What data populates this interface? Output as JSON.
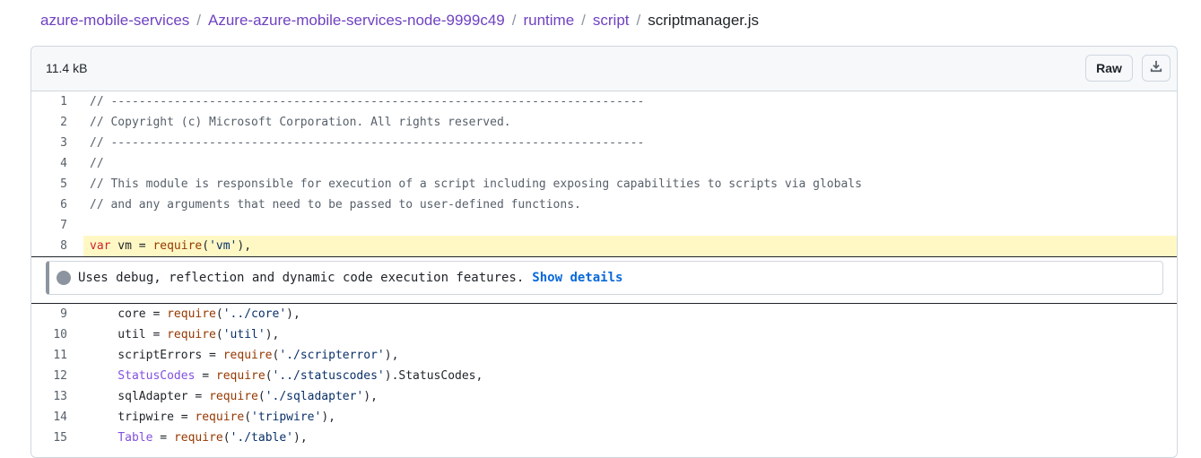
{
  "breadcrumb": {
    "items": [
      "azure-mobile-services",
      "Azure-azure-mobile-services-node-9999c49",
      "runtime",
      "script"
    ],
    "separator": "/",
    "current": "scriptmanager.js"
  },
  "file": {
    "size": "11.4 kB",
    "raw_label": "Raw",
    "download_icon": "download-icon"
  },
  "notice": {
    "message": "Uses debug, reflection and dynamic code execution features.",
    "link": "Show details"
  },
  "colors": {
    "link": "#6f42c1",
    "keyword": "#cf222e",
    "function": "#953800",
    "string": "#0a3069",
    "type": "#8250df",
    "comment": "#57606a",
    "highlight": "#fff8c5"
  },
  "code": {
    "lines_before": [
      {
        "n": "1",
        "tokens": [
          [
            "c",
            "// ----------------------------------------------------------------------------"
          ]
        ]
      },
      {
        "n": "2",
        "tokens": [
          [
            "c",
            "// Copyright (c) Microsoft Corporation. All rights reserved."
          ]
        ]
      },
      {
        "n": "3",
        "tokens": [
          [
            "c",
            "// ----------------------------------------------------------------------------"
          ]
        ]
      },
      {
        "n": "4",
        "tokens": [
          [
            "c",
            "//"
          ]
        ]
      },
      {
        "n": "5",
        "tokens": [
          [
            "c",
            "// This module is responsible for execution of a script including exposing capabilities to scripts via globals"
          ]
        ]
      },
      {
        "n": "6",
        "tokens": [
          [
            "c",
            "// and any arguments that need to be passed to user-defined functions."
          ]
        ]
      },
      {
        "n": "7",
        "tokens": []
      },
      {
        "n": "8",
        "highlight": true,
        "tokens": [
          [
            "k",
            "var"
          ],
          [
            "",
            " vm = "
          ],
          [
            "f",
            "require"
          ],
          [
            "",
            "("
          ],
          [
            "s",
            "'vm'"
          ],
          [
            "",
            "),"
          ]
        ]
      }
    ],
    "lines_after": [
      {
        "n": "9",
        "tokens": [
          [
            "",
            "    core = "
          ],
          [
            "f",
            "require"
          ],
          [
            "",
            "("
          ],
          [
            "s",
            "'../core'"
          ],
          [
            "",
            "),"
          ]
        ]
      },
      {
        "n": "10",
        "tokens": [
          [
            "",
            "    util = "
          ],
          [
            "f",
            "require"
          ],
          [
            "",
            "("
          ],
          [
            "s",
            "'util'"
          ],
          [
            "",
            "),"
          ]
        ]
      },
      {
        "n": "11",
        "tokens": [
          [
            "",
            "    scriptErrors = "
          ],
          [
            "f",
            "require"
          ],
          [
            "",
            "("
          ],
          [
            "s",
            "'./scripterror'"
          ],
          [
            "",
            "),"
          ]
        ]
      },
      {
        "n": "12",
        "tokens": [
          [
            "t",
            "    StatusCodes"
          ],
          [
            "",
            " = "
          ],
          [
            "f",
            "require"
          ],
          [
            "",
            "("
          ],
          [
            "s",
            "'../statuscodes'"
          ],
          [
            "",
            ").StatusCodes,"
          ]
        ]
      },
      {
        "n": "13",
        "tokens": [
          [
            "",
            "    sqlAdapter = "
          ],
          [
            "f",
            "require"
          ],
          [
            "",
            "("
          ],
          [
            "s",
            "'./sqladapter'"
          ],
          [
            "",
            "),"
          ]
        ]
      },
      {
        "n": "14",
        "tokens": [
          [
            "",
            "    tripwire = "
          ],
          [
            "f",
            "require"
          ],
          [
            "",
            "("
          ],
          [
            "s",
            "'tripwire'"
          ],
          [
            "",
            "),"
          ]
        ]
      },
      {
        "n": "15",
        "tokens": [
          [
            "t",
            "    Table"
          ],
          [
            "",
            " = "
          ],
          [
            "f",
            "require"
          ],
          [
            "",
            "("
          ],
          [
            "s",
            "'./table'"
          ],
          [
            "",
            "),"
          ]
        ]
      }
    ]
  }
}
